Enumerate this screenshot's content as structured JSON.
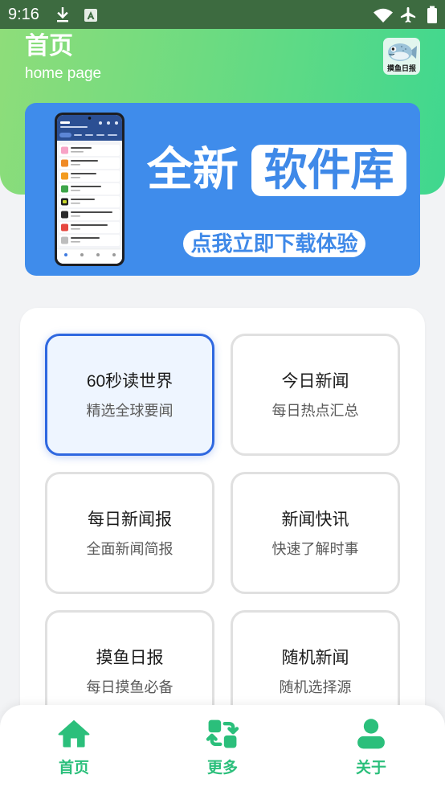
{
  "status_bar": {
    "time": "9:16",
    "left_icons": [
      "download-icon",
      "a-notification-icon"
    ],
    "right_icons": [
      "wifi-icon",
      "airplane-mode-icon",
      "battery-icon"
    ]
  },
  "header": {
    "title": "首页",
    "subtitle": "home page",
    "app_logo_text": "摸鱼日报",
    "app_logo_icon": "fish-icon"
  },
  "banner": {
    "headline": "全新",
    "highlight": "软件库",
    "cta": "点我立即下载体验"
  },
  "news_sources": {
    "selected_index": 0,
    "items": [
      {
        "title": "60秒读世界",
        "subtitle": "精选全球要闻"
      },
      {
        "title": "今日新闻",
        "subtitle": "每日热点汇总"
      },
      {
        "title": "每日新闻报",
        "subtitle": "全面新闻简报"
      },
      {
        "title": "新闻快讯",
        "subtitle": "快速了解时事"
      },
      {
        "title": "摸鱼日报",
        "subtitle": "每日摸鱼必备"
      },
      {
        "title": "随机新闻",
        "subtitle": "随机选择源"
      }
    ]
  },
  "bottom_nav": {
    "items": [
      {
        "label": "首页",
        "icon": "home-icon"
      },
      {
        "label": "更多",
        "icon": "swap-refresh-icon"
      },
      {
        "label": "关于",
        "icon": "person-icon"
      }
    ]
  },
  "colors": {
    "status_bar": "#3d6b40",
    "header_gradient_start": "#8edd7a",
    "header_gradient_end": "#3fd78f",
    "banner_background": "#3f8ceb",
    "banner_accent_text": "#3f89e8",
    "selected_border": "#2f68e0",
    "selected_background": "#eef5ff",
    "nav_accent": "#2bbf7b",
    "page_background": "#f2f3f5"
  }
}
